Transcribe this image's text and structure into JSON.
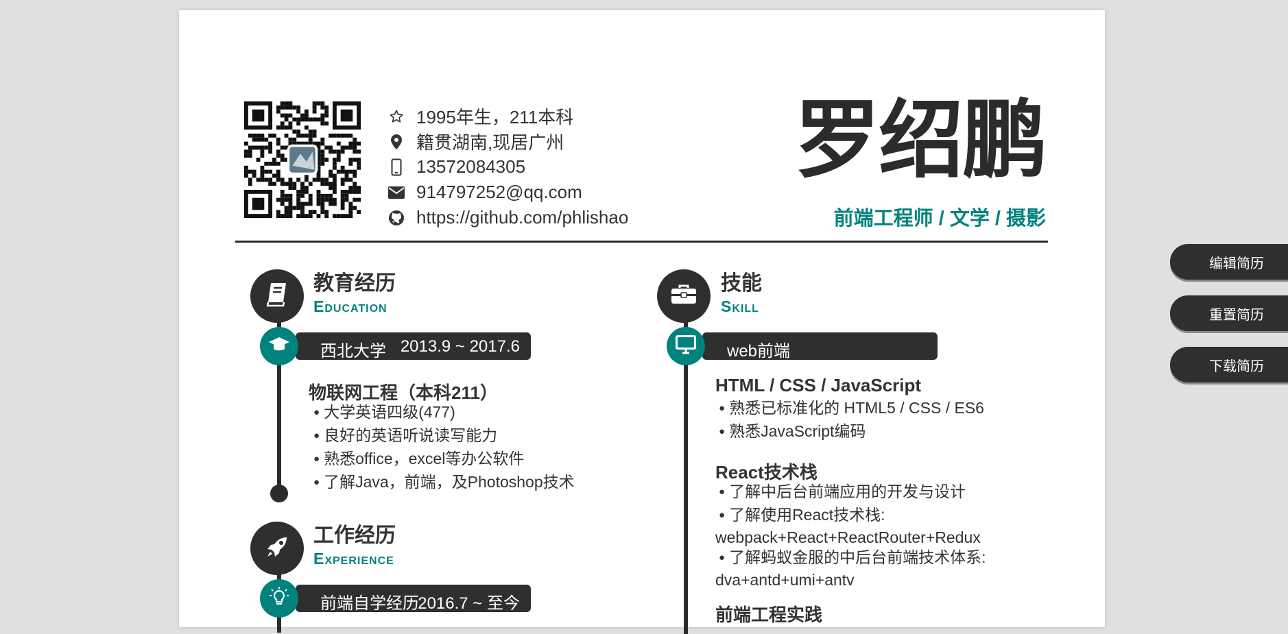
{
  "profile": {
    "name": "罗绍鹏",
    "subtitle": "前端工程师 / 文学 / 摄影",
    "info": [
      {
        "icon": "star-icon",
        "text": "1995年生，211本科"
      },
      {
        "icon": "location-pin-icon",
        "text": "籍贯湖南,现居广州"
      },
      {
        "icon": "mobile-phone-icon",
        "text": "13572084305"
      },
      {
        "icon": "envelope-icon",
        "text": "914797252@qq.com"
      },
      {
        "icon": "github-icon",
        "text": "https://github.com/phlishao"
      }
    ]
  },
  "education": {
    "title": "教育经历",
    "subtitle": "Education",
    "icon": "book-icon",
    "entry": {
      "icon": "graduation-cap-icon",
      "label": "西北大学",
      "date": "2013.9 ~ 2017.6",
      "heading": "物联网工程（本科211）",
      "bullets": [
        "大学英语四级(477)",
        "良好的英语听说读写能力",
        "熟悉office，excel等办公软件",
        "了解Java，前端，及Photoshop技术"
      ]
    }
  },
  "experience": {
    "title": "工作经历",
    "subtitle": "Experience",
    "icon": "rocket-icon",
    "entry": {
      "icon": "lightbulb-icon",
      "label": "前端自学经历",
      "date": "2016.7 ~ 至今"
    }
  },
  "skills": {
    "title": "技能",
    "subtitle": "Skill",
    "icon": "toolbox-icon",
    "entry": {
      "icon": "monitor-icon",
      "label": "web前端"
    },
    "groups": [
      {
        "heading": "HTML / CSS / JavaScript",
        "bullets": [
          "熟悉已标准化的 HTML5 / CSS / ES6",
          "熟悉JavaScript编码"
        ]
      },
      {
        "heading": "React技术栈",
        "bullets": [
          "了解中后台前端应用的开发与设计",
          "了解使用React技术栈:"
        ],
        "cont1": "webpack+React+ReactRouter+Redux",
        "bullet3": "了解蚂蚁金服的中后台前端技术体系:",
        "cont2": "dva+antd+umi+antv"
      },
      {
        "heading": "前端工程实践"
      }
    ]
  },
  "actions": {
    "edit": "编辑简历",
    "reset": "重置简历",
    "download": "下载简历"
  },
  "colors": {
    "accent": "#00827f",
    "dark": "#2f2f2f",
    "background": "#e0e0e0"
  }
}
